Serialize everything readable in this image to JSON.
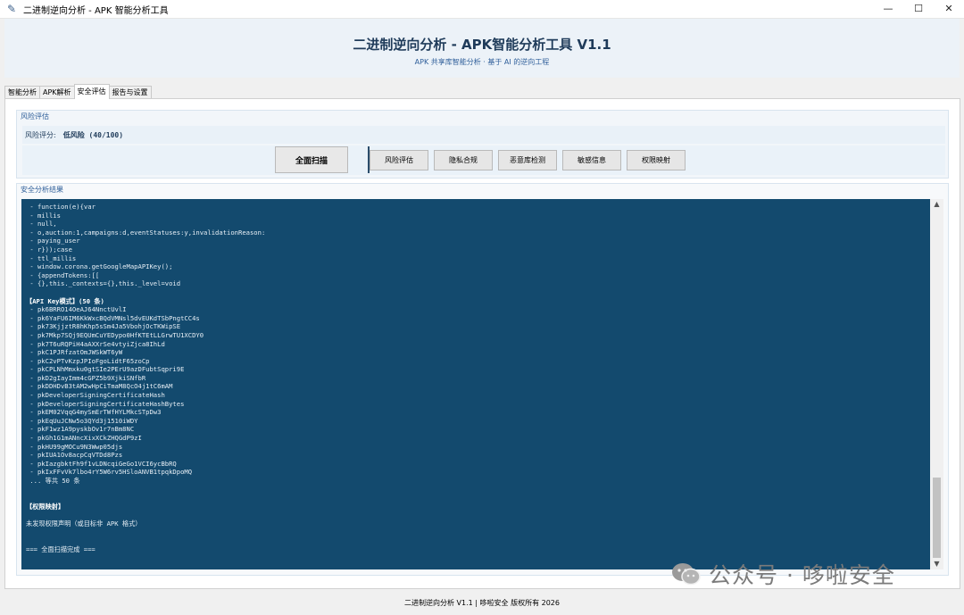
{
  "window": {
    "title": "二进制逆向分析 - APK 智能分析工具",
    "minimize_glyph": "—",
    "maximize_glyph": "☐",
    "close_glyph": "✕"
  },
  "header": {
    "title": "二进制逆向分析 - APK智能分析工具 V1.1",
    "subtitle": "APK 共享库智能分析 · 基于 AI 的逆向工程"
  },
  "tabs": [
    {
      "label": "智能分析"
    },
    {
      "label": "APK解析"
    },
    {
      "label": "安全评估"
    },
    {
      "label": "报告与设置"
    }
  ],
  "risk": {
    "group_title": "风险评估",
    "score_label": "风险评分:",
    "score_value": "低风险 (40/100)"
  },
  "buttons": {
    "full_scan": "全面扫描",
    "risk_eval": "风险评估",
    "privacy": "隐私合规",
    "malware": "恶意库检测",
    "sensitive": "敏感信息",
    "permission": "权限映射"
  },
  "results": {
    "group_title": "安全分析结果",
    "lines": [
      " - function(e){var",
      " - millis",
      " - null,",
      " - o,auction:1,campaigns:d,eventStatuses:y,invalidationReason:",
      " - paying_user",
      " - r}));case",
      " - ttl_millis",
      " - window.corona.getGoogleMapAPIKey();",
      " - {appendTokens:[[",
      " - {},this._contexts={},this._level=void",
      "",
      "【API Key模式】(50 条)",
      " - pk6BRRO14OeAJ64NnctUvlI",
      " - pk6YaFU6IM6KkWxcBQdVMNsl5dvEUKdTSbPngtCC4s",
      " - pk73KjjztR8hKhp5sSm4Ja5VbohjOcTKWipSE",
      " - pk7Mkp7SQj9EQUmCuYEDypo0HfKTEtLLGrwTU1XCDY0",
      " - pk7T6uRQPiH4aAXXrSe4vtyiZjca8IhLd",
      " - pkC1PJRfzatOmJWSkWT6yW",
      " - pkC2vPTvKzpJPIoFgoLidtF65zoCp",
      " - pkCPLNhMmxku0gtSIe2PErU9azDFubtSqpri9E",
      " - pkD2gIayImm4cGPZ5b9XjkiSNfbR",
      " - pkDDHDvB3tAM2wHpCiTmaM8QcO4j1tC6mAM",
      " - pkDeveloperSigningCertificateHash",
      " - pkDeveloperSigningCertificateHashBytes",
      " - pkEM02VqqG4mySmErTWfHYLMkcSTpDw3",
      " - pkEqUuJCNw5o3QYd3j1510iWDY",
      " - pkF1wz1A9pyskbOv1r7nBm8NC",
      " - pkGh1G1mANncXixXCkZHQGdP9zI",
      " - pkHU99gMOCu9N3Wwp05djs",
      " - pkIUA1Ov8acpCqVTDd8Pzs",
      " - pkIazgbktFh9f1vLDNcqiGeGo1VCI6ycBbRQ",
      " - pkIxFFvVk7lbo4rY5W6rv5HSloANVB1tpqkDpoMQ",
      " ... 等共 50 条",
      "",
      "",
      "【权限映射】",
      "",
      "未发现权限声明（或目标非 APK 格式）",
      "",
      "",
      "=== 全面扫描完成 ==="
    ]
  },
  "footer": {
    "text": "二进制逆向分析 V1.1 | 哆啦安全 版权所有 2026"
  },
  "watermark": {
    "text": "公众号 · 哆啦安全"
  }
}
